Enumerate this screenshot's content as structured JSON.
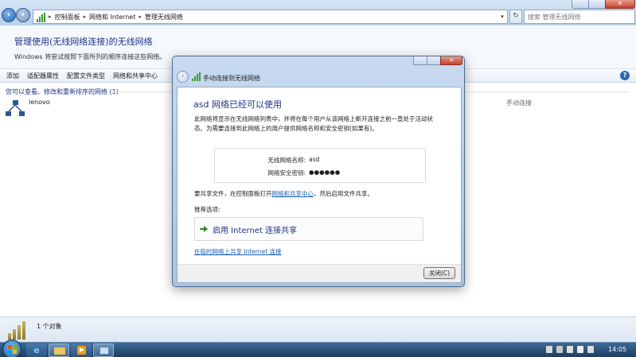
{
  "window": {
    "close_glyph": "✕"
  },
  "address": {
    "crumbs": [
      "控制面板",
      "网络和 Internet",
      "管理无线网络"
    ],
    "search_placeholder": "搜索 管理无线网络"
  },
  "header": {
    "title": "管理使用(无线网络连接)的无线网络",
    "subtitle": "Windows 将尝试按照下面所列的顺序连接这些网络。"
  },
  "toolbar": {
    "items": [
      "添加",
      "适配器属性",
      "配置文件类型",
      "网络和共享中心"
    ],
    "help_glyph": "?"
  },
  "list": {
    "group_header": "您可以查看、修改和重新排序的网络 (1)",
    "networks": [
      {
        "name": "lenovo",
        "mode": "手动连接"
      }
    ]
  },
  "details": {
    "count_text": "1 个对象"
  },
  "taskbar": {
    "clock": "14:05"
  },
  "dialog": {
    "title": "手动连接到无线网络",
    "close_glyph": "✕",
    "heading": "asd 网络已经可以使用",
    "description": "此网络将显示在无线网络列表中，并将在每个用户从该网络上断开连接之前一直处于活动状态。为需要连接到此网络上的用户提供网络名称和安全密钥(如果有)。",
    "info": {
      "name_label": "无线网络名称:",
      "name_value": "asd",
      "key_label": "网络安全密钥:",
      "key_value": "●●●●●●"
    },
    "share_prefix": "要共享文件，在控制面板打开",
    "share_link": "网络和共享中心",
    "share_suffix": "，然后启用文件共享。",
    "recommend_label": "推荐选项:",
    "command_label": "启用 Internet 连接共享",
    "adhoc_link": "在临时网络上共享 Internet 连接",
    "close_button": "关闭(C)"
  },
  "colors": {
    "title_blue": "#1e3287",
    "link_blue": "#1a5fb4",
    "taskbar": "#1d3d60"
  }
}
